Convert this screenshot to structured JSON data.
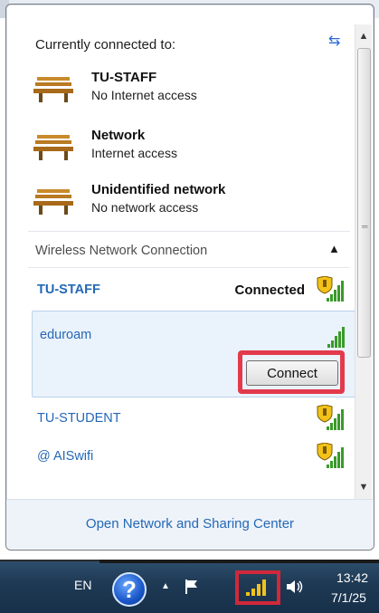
{
  "popup": {
    "header": "Currently connected to:",
    "connected_networks": [
      {
        "name": "TU-STAFF",
        "status": "No Internet access"
      },
      {
        "name": "Network",
        "status": "Internet access"
      },
      {
        "name": "Unidentified network",
        "status": "No network access"
      }
    ],
    "section_title": "Wireless Network Connection",
    "wifi": [
      {
        "ssid": "TU-STAFF",
        "state": "Connected",
        "secured": true
      },
      {
        "ssid": "eduroam",
        "secured": false,
        "action": "Connect"
      },
      {
        "ssid": "TU-STUDENT",
        "secured": true
      },
      {
        "ssid": "@ AISwifi",
        "secured": true
      }
    ],
    "footer_link": "Open Network and Sharing Center"
  },
  "taskbar": {
    "language": "EN",
    "time": "13:42",
    "date": "7/1/25"
  },
  "colors": {
    "link_blue": "#2468b6",
    "highlight_red": "#e23a4c",
    "signal_green": "#3a9a2a",
    "shield_yellow": "#f2c21b"
  }
}
